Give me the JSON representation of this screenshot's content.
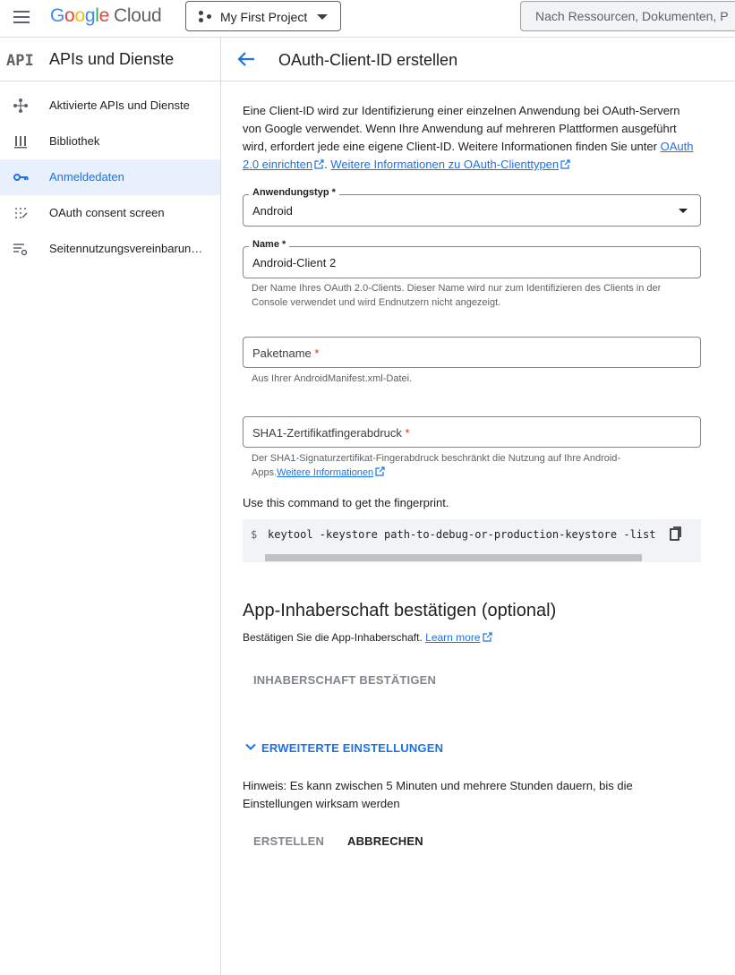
{
  "topbar": {
    "logo_letters": [
      "G",
      "o",
      "o",
      "g",
      "l",
      "e"
    ],
    "logo_suffix": "Cloud",
    "project": "My First Project",
    "search_placeholder": "Nach Ressourcen, Dokumenten, P"
  },
  "sidebar": {
    "badge": "API",
    "title": "APIs und Dienste",
    "items": [
      {
        "label": "Aktivierte APIs und Dienste",
        "icon": "hub-icon"
      },
      {
        "label": "Bibliothek",
        "icon": "library-icon"
      },
      {
        "label": "Anmeldedaten",
        "icon": "key-icon",
        "active": true
      },
      {
        "label": "OAuth consent screen",
        "icon": "consent-dots-icon"
      },
      {
        "label": "Seitennutzungsvereinbarung…",
        "icon": "settings-list-icon"
      }
    ]
  },
  "header": {
    "title": "OAuth-Client-ID erstellen"
  },
  "intro": {
    "text": "Eine Client-ID wird zur Identifizierung einer einzelnen Anwendung bei OAuth-Servern von Google verwendet. Wenn Ihre Anwendung auf mehreren Plattformen ausgeführt wird, erfordert jede eine eigene Client-ID. Weitere Informationen finden Sie unter ",
    "link1": "OAuth 2.0 einrichten",
    "sep": ". ",
    "link2": "Weitere Informationen zu OAuth-Clienttypen"
  },
  "form": {
    "app_type": {
      "label": "Anwendungstyp",
      "required_mark": "*",
      "value": "Android"
    },
    "name": {
      "label": "Name",
      "required_mark": "*",
      "value": "Android-Client 2",
      "help": "Der Name Ihres OAuth 2.0-Clients. Dieser Name wird nur zum Identifizieren des Clients in der Console verwendet und wird Endnutzern nicht angezeigt."
    },
    "package": {
      "label": "Paketname",
      "required_mark": "*",
      "value": "",
      "help": "Aus Ihrer AndroidManifest.xml-Datei."
    },
    "sha1": {
      "label": "SHA1-Zertifikatfingerabdruck",
      "required_mark": "*",
      "value": "",
      "help": "Der SHA1-Signaturzertifikat-Fingerabdruck beschränkt die Nutzung auf Ihre Android-Apps.",
      "help_link": "Weitere Informationen"
    }
  },
  "command": {
    "label": "Use this command to get the fingerprint.",
    "prompt": "$",
    "code": "keytool -keystore path-to-debug-or-production-keystore -list"
  },
  "ownership": {
    "title": "App-Inhaberschaft bestätigen (optional)",
    "text": "Bestätigen Sie die App-Inhaberschaft. ",
    "link": "Learn more",
    "button": "INHABERSCHAFT BESTÄTIGEN"
  },
  "advanced": {
    "label": "ERWEITERTE EINSTELLUNGEN"
  },
  "note": "Hinweis: Es kann zwischen 5 Minuten und mehrere Stunden dauern, bis die Einstellungen wirksam werden",
  "actions": {
    "create": "ERSTELLEN",
    "cancel": "ABBRECHEN"
  },
  "colors": {
    "accent": "#1a73e8",
    "active_bg": "#e8f0fe",
    "required": "#d93025"
  }
}
